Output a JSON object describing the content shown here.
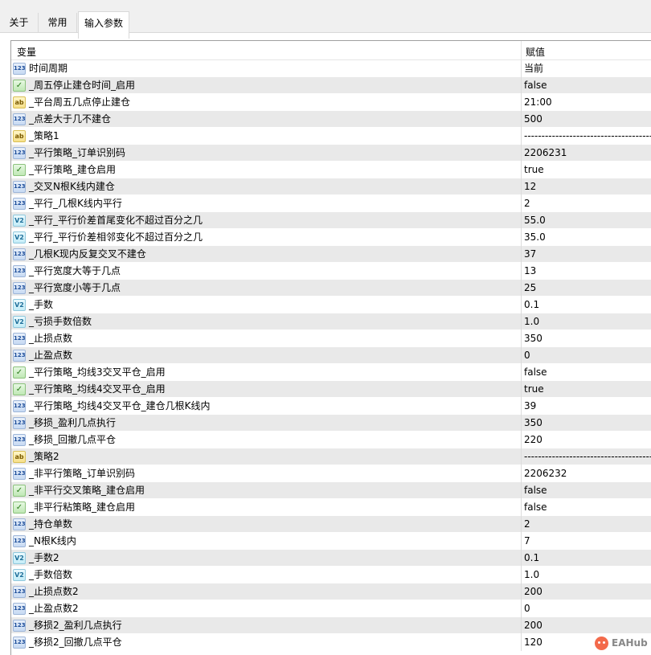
{
  "tabs": [
    {
      "label": "关于",
      "active": false
    },
    {
      "label": "常用",
      "active": false
    },
    {
      "label": "输入参数",
      "active": true
    }
  ],
  "columns": {
    "name": "变量",
    "value": "赋值"
  },
  "params": [
    {
      "type": "int",
      "name": "时间周期",
      "value": "当前"
    },
    {
      "type": "bool",
      "name": "_周五停止建仓时间_启用",
      "value": "false"
    },
    {
      "type": "str",
      "name": "_平台周五几点停止建仓",
      "value": "21:00"
    },
    {
      "type": "int",
      "name": "_点差大于几不建仓",
      "value": "500"
    },
    {
      "type": "str",
      "name": "_策略1",
      "value": "--------------------------------------------"
    },
    {
      "type": "int",
      "name": "_平行策略_订单识别码",
      "value": "2206231"
    },
    {
      "type": "bool",
      "name": "_平行策略_建仓启用",
      "value": "true"
    },
    {
      "type": "int",
      "name": "_交叉N根K线内建仓",
      "value": "12"
    },
    {
      "type": "int",
      "name": "_平行_几根K线内平行",
      "value": "2"
    },
    {
      "type": "dbl",
      "name": "_平行_平行价差首尾变化不超过百分之几",
      "value": "55.0"
    },
    {
      "type": "dbl",
      "name": "_平行_平行价差相邻变化不超过百分之几",
      "value": "35.0"
    },
    {
      "type": "int",
      "name": "_几根K现内反复交叉不建仓",
      "value": "37"
    },
    {
      "type": "int",
      "name": "_平行宽度大等于几点",
      "value": "13"
    },
    {
      "type": "int",
      "name": "_平行宽度小等于几点",
      "value": "25"
    },
    {
      "type": "dbl",
      "name": "_手数",
      "value": "0.1"
    },
    {
      "type": "dbl",
      "name": "_亏损手数倍数",
      "value": "1.0"
    },
    {
      "type": "int",
      "name": "_止损点数",
      "value": "350"
    },
    {
      "type": "int",
      "name": "_止盈点数",
      "value": "0"
    },
    {
      "type": "bool",
      "name": "_平行策略_均线3交叉平仓_启用",
      "value": "false"
    },
    {
      "type": "bool",
      "name": "_平行策略_均线4交叉平仓_启用",
      "value": "true"
    },
    {
      "type": "int",
      "name": "_平行策略_均线4交叉平仓_建仓几根K线内",
      "value": "39"
    },
    {
      "type": "int",
      "name": "_移损_盈利几点执行",
      "value": "350"
    },
    {
      "type": "int",
      "name": "_移损_回撤几点平仓",
      "value": "220"
    },
    {
      "type": "str",
      "name": "_策略2",
      "value": "--------------------------------------------"
    },
    {
      "type": "int",
      "name": "_非平行策略_订单识别码",
      "value": "2206232"
    },
    {
      "type": "bool",
      "name": "_非平行交叉策略_建仓启用",
      "value": "false"
    },
    {
      "type": "bool",
      "name": "_非平行粘策略_建仓启用",
      "value": "false"
    },
    {
      "type": "int",
      "name": "_持仓单数",
      "value": "2"
    },
    {
      "type": "int",
      "name": "_N根K线内",
      "value": "7"
    },
    {
      "type": "dbl",
      "name": "_手数2",
      "value": "0.1"
    },
    {
      "type": "dbl",
      "name": "_手数倍数",
      "value": "1.0"
    },
    {
      "type": "int",
      "name": "_止损点数2",
      "value": "200"
    },
    {
      "type": "int",
      "name": "_止盈点数2",
      "value": "0"
    },
    {
      "type": "int",
      "name": "_移损2_盈利几点执行",
      "value": "200"
    },
    {
      "type": "int",
      "name": "_移损2_回撤几点平仓",
      "value": "120"
    }
  ],
  "icon_glyphs": {
    "int": "123",
    "dbl": "V2",
    "str": "ab",
    "bool": "✓"
  },
  "icon_names": {
    "int": "integer-type-icon",
    "dbl": "double-type-icon",
    "str": "string-type-icon",
    "bool": "bool-type-icon"
  },
  "watermark": {
    "text": "EAHub"
  },
  "colors": {
    "row_alt": "#e9e9e9",
    "grid_border": "#a0a0a0"
  }
}
